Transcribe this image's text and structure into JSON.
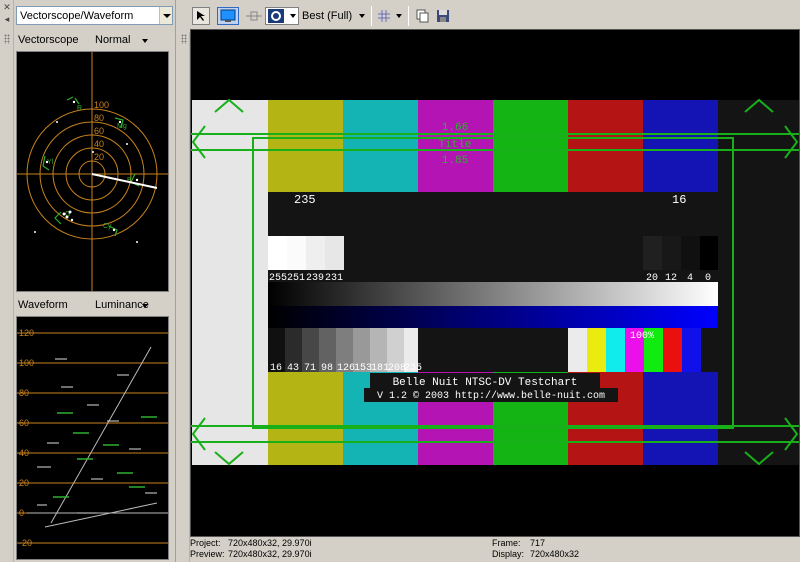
{
  "left_panel": {
    "view_selector": "Vectorscope/Waveform",
    "vectorscope": {
      "label": "Vectorscope",
      "mode": "Normal",
      "ring_labels": [
        "100",
        "80",
        "60",
        "40",
        "20"
      ],
      "targets": [
        "R",
        "Mg",
        "B",
        "Cy",
        "G",
        "Yl"
      ]
    },
    "waveform": {
      "label": "Waveform",
      "mode": "Luminance",
      "scale": [
        "120",
        "100",
        "80",
        "60",
        "40",
        "20",
        "0",
        "-20"
      ]
    }
  },
  "toolbar": {
    "quality": "Best (Full)"
  },
  "testchart": {
    "upper_labels": [
      "235",
      "16"
    ],
    "center_lines": [
      "1.66",
      "Title",
      "1.85"
    ],
    "gray_labels_left": [
      "255",
      "251",
      "239",
      "231"
    ],
    "gray_labels_right": [
      "20",
      "12",
      "4",
      "0"
    ],
    "step_labels": [
      "16",
      "43",
      "71",
      "98",
      "126",
      "153",
      "181",
      "208",
      "235"
    ],
    "percent": "100%",
    "title": "Belle Nuit NTSC-DV Testchart",
    "version": "V 1.2 © 2003 http://www.belle-nuit.com"
  },
  "status": {
    "project_label": "Project:",
    "project_value": "720x480x32, 29.970i",
    "preview_label": "Preview:",
    "preview_value": "720x480x32, 29.970i",
    "frame_label": "Frame:",
    "frame_value": "717",
    "display_label": "Display:",
    "display_value": "720x480x32"
  },
  "colors": {
    "panel": "#d4d0c8",
    "scope_graticule": "#c8821e",
    "safe_area": "#18b018"
  }
}
